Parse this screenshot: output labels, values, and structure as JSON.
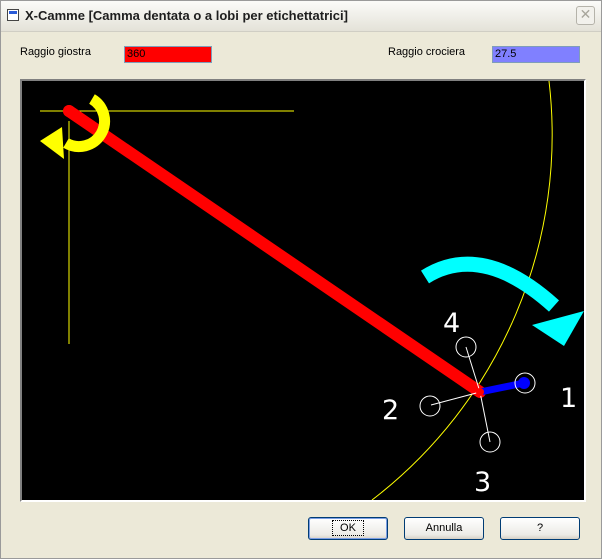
{
  "window": {
    "title": "X-Camme [Camma dentata o a lobi per etichettatrici]",
    "close_glyph": "✕"
  },
  "fields": {
    "raggio_giostra": {
      "label": "Raggio giostra",
      "value": "360",
      "color": "#FF0000"
    },
    "raggio_crociera": {
      "label": "Raggio crociera",
      "value": "27.5",
      "color": "#8080FF"
    }
  },
  "canvas": {
    "background": "#000000",
    "colors": {
      "crosshair": "#FFFF00",
      "arc": "#FFFF00",
      "main_arm": "#FF0000",
      "cross_arm": "#0000FF",
      "rotation_arrow_main": "#FFFF00",
      "rotation_arrow_cross": "#00FFFF",
      "lobes": "#FFFFFF"
    },
    "icons": [
      "rotate-ccw-arrow-icon",
      "rotate-cw-arrow-icon"
    ],
    "lobe_labels": [
      "1",
      "2",
      "3",
      "4"
    ]
  },
  "buttons": {
    "ok": "OK",
    "annulla": "Annulla",
    "help": "?"
  }
}
